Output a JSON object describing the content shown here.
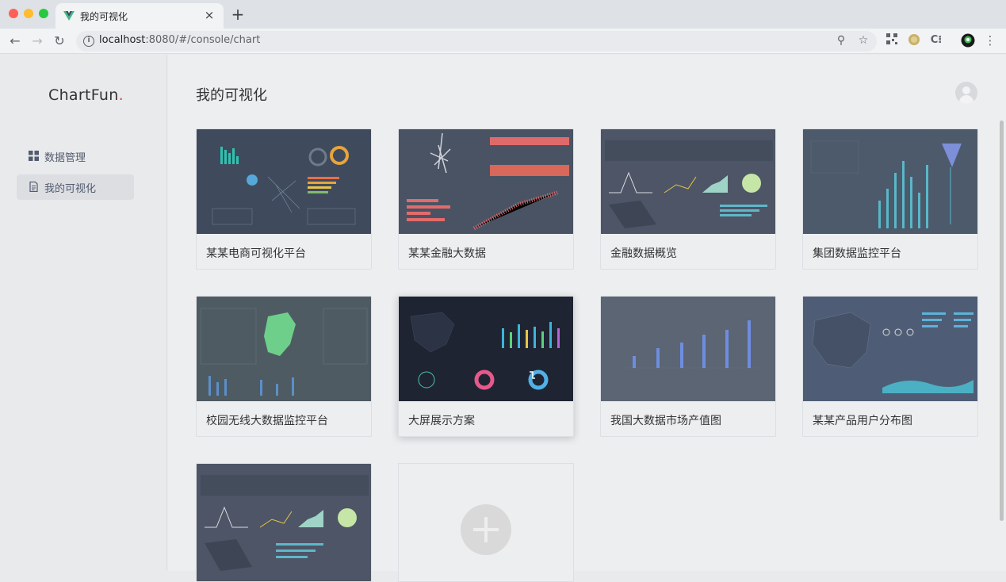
{
  "browser": {
    "tab_title": "我的可视化",
    "tab_close": "×",
    "new_tab": "+",
    "url_host": "localhost",
    "url_rest": ":8080/#/console/chart"
  },
  "sidebar": {
    "logo_text": "ChartFun",
    "logo_dot": ".",
    "items": [
      {
        "label": "数据管理",
        "active": false
      },
      {
        "label": "我的可视化",
        "active": true
      }
    ]
  },
  "main": {
    "title": "我的可视化",
    "cards": [
      {
        "label": "某某电商可视化平台"
      },
      {
        "label": "某某金融大数据"
      },
      {
        "label": "金融数据概览"
      },
      {
        "label": "集团数据监控平台"
      },
      {
        "label": "校园无线大数据监控平台"
      },
      {
        "label": "大屏展示方案"
      },
      {
        "label": "我国大数据市场产值图"
      },
      {
        "label": "某某产品用户分布图"
      }
    ]
  },
  "colors": {
    "accent": "#e8414f",
    "thumb_bg": "#4a5565"
  }
}
